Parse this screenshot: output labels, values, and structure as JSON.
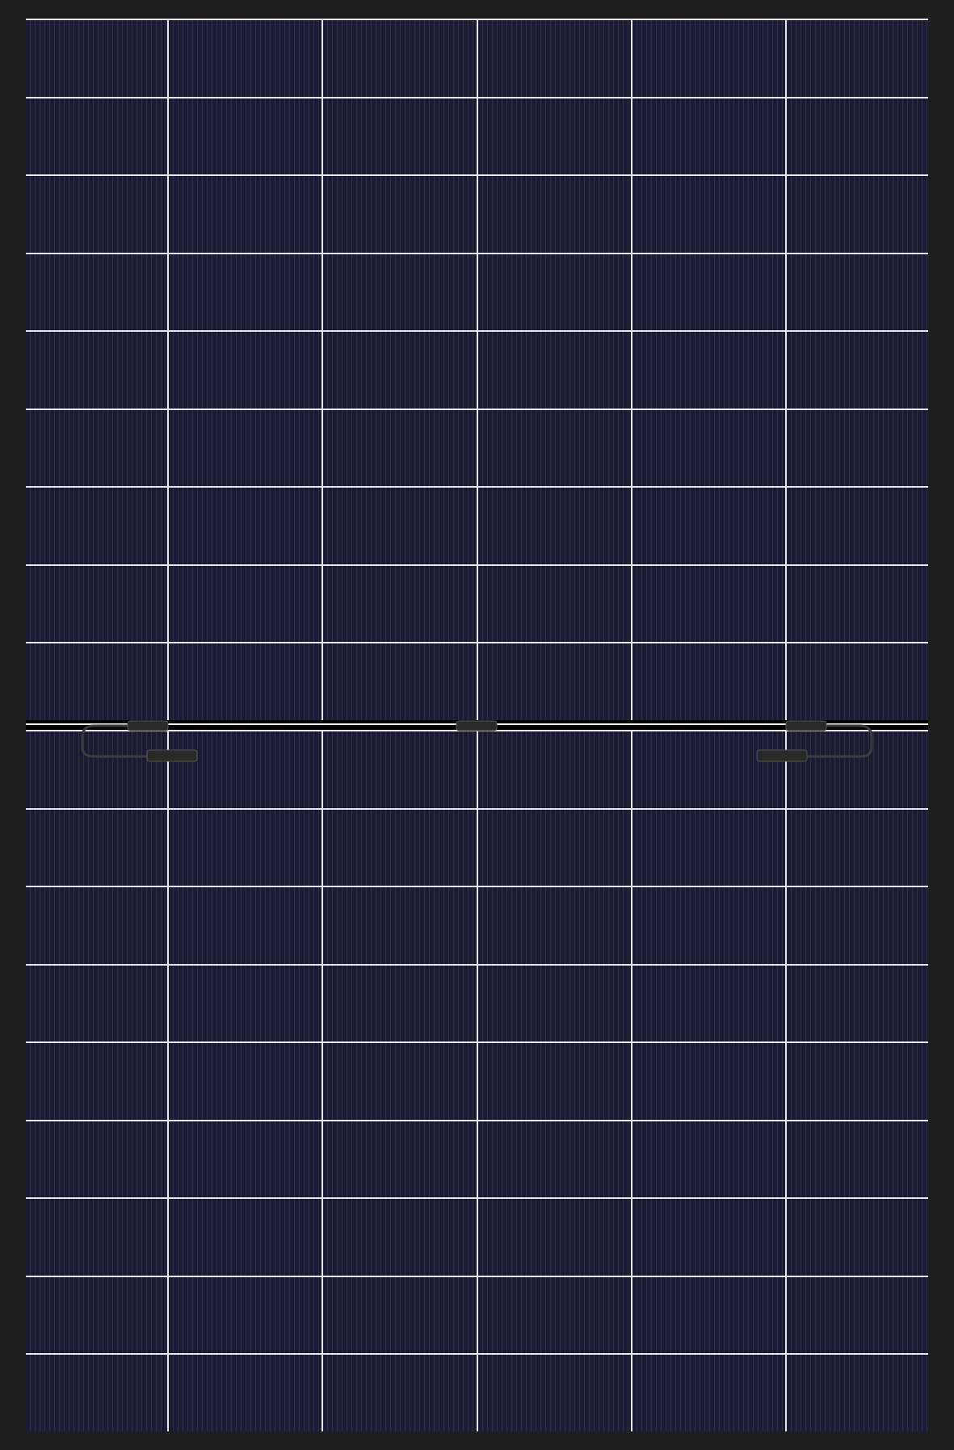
{
  "panel": {
    "columns": [
      {
        "kind": "edge"
      },
      {
        "kind": "inner"
      },
      {
        "kind": "inner"
      },
      {
        "kind": "inner"
      },
      {
        "kind": "inner"
      },
      {
        "kind": "edge"
      }
    ],
    "upper_rows": [
      {
        "kind": "cell_row"
      },
      {
        "kind": "cell_row"
      },
      {
        "kind": "cell_row"
      },
      {
        "kind": "cell_row"
      },
      {
        "kind": "cell_row"
      },
      {
        "kind": "cell_row"
      },
      {
        "kind": "cell_row"
      },
      {
        "kind": "cell_row"
      },
      {
        "kind": "cell_row"
      }
    ],
    "lower_rows": [
      {
        "kind": "cell_row"
      },
      {
        "kind": "cell_row"
      },
      {
        "kind": "cell_row"
      },
      {
        "kind": "cell_row"
      },
      {
        "kind": "cell_row"
      },
      {
        "kind": "cell_row"
      },
      {
        "kind": "cell_row"
      },
      {
        "kind": "cell_row"
      },
      {
        "kind": "cell_row"
      }
    ],
    "connectors": [
      {
        "kind": "end_left"
      },
      {
        "kind": "middle"
      },
      {
        "kind": "end_right"
      }
    ]
  }
}
